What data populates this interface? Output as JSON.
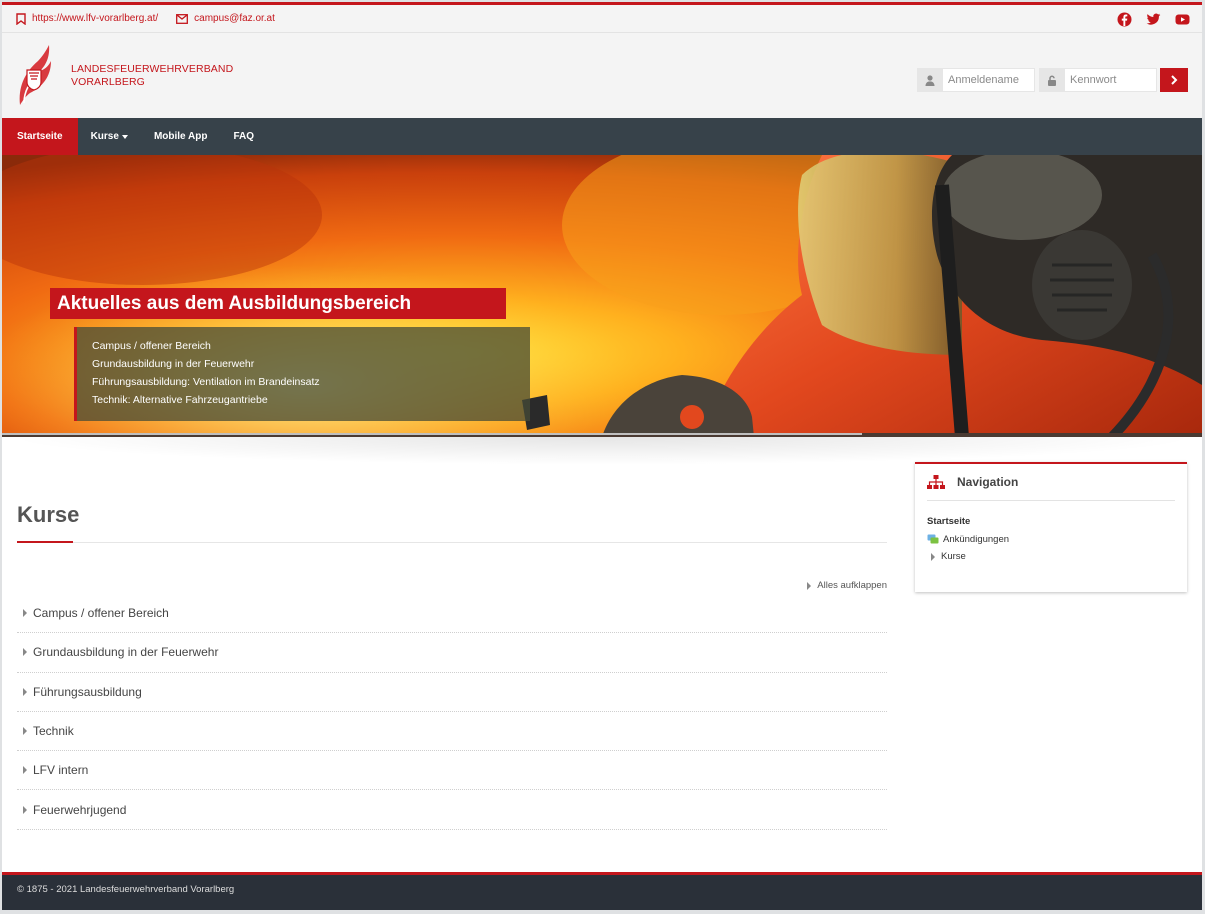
{
  "topbar": {
    "website": "https://www.lfv-vorarlberg.at/",
    "email": "campus@faz.or.at",
    "social": [
      "facebook-icon",
      "twitter-icon",
      "youtube-icon"
    ]
  },
  "header": {
    "brand_line1": "LANDESFEUERWEHRVERBAND",
    "brand_line2": "VORARLBERG",
    "login": {
      "username_placeholder": "Anmeldename",
      "password_placeholder": "Kennwort"
    }
  },
  "nav": {
    "items": [
      "Startseite",
      "Kurse",
      "Mobile App",
      "FAQ"
    ],
    "active": "Startseite"
  },
  "hero": {
    "title": "Aktuelles aus dem Ausbildungsbereich",
    "lines": [
      "Campus / offener Bereich",
      "Grundausbildung in der Feuerwehr",
      "Führungsausbildung: Ventilation im Brandeinsatz",
      "Technik: Alternative Fahrzeugantriebe"
    ]
  },
  "main": {
    "title": "Kurse",
    "expand_all": "Alles aufklappen",
    "categories": [
      "Campus / offener Bereich",
      "Grundausbildung in der Feuerwehr",
      "Führungsausbildung",
      "Technik",
      "LFV intern",
      "Feuerwehrjugend"
    ]
  },
  "navigation_block": {
    "title": "Navigation",
    "home": "Startseite",
    "items": [
      "Ankündigungen",
      "Kurse"
    ]
  },
  "footer": {
    "copyright": "© 1875 - 2021 Landesfeuerwehrverband Vorarlberg"
  },
  "colors": {
    "accent": "#c4161c",
    "navbar": "#37424a",
    "footer": "#2a3039"
  }
}
